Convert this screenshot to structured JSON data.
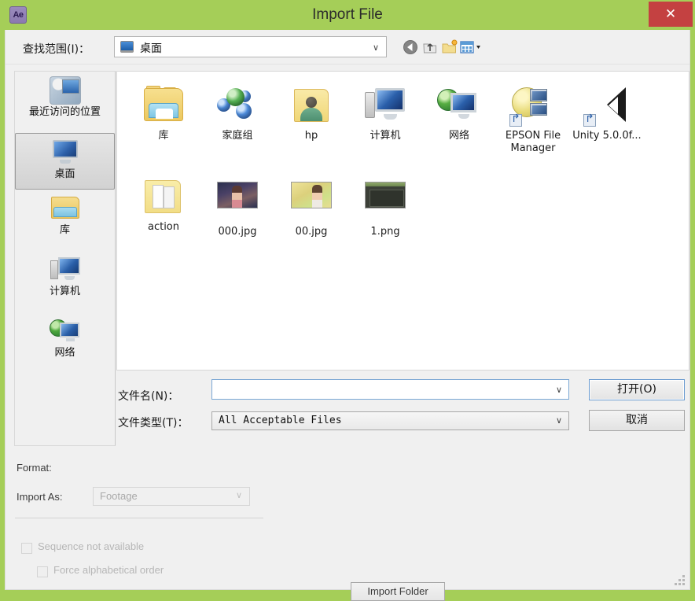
{
  "titlebar": {
    "app_icon": "after-effects-icon",
    "app_icon_text": "Ae",
    "title": "Import File",
    "close_label": "✕",
    "accent_color": "#a5ce58",
    "close_color": "#c44141"
  },
  "navbar": {
    "lookin_label": "查找范围(I)：",
    "lookin_value": "桌面",
    "dropdown_arrow": "∨",
    "toolbar_icons": [
      {
        "name": "back-icon",
        "glyph": "◀"
      },
      {
        "name": "up-folder-icon",
        "glyph": "▲"
      },
      {
        "name": "new-folder-icon",
        "glyph": "📁"
      },
      {
        "name": "views-icon",
        "glyph": "▦"
      }
    ]
  },
  "sidebar": {
    "items": [
      {
        "label": "最近访问的位置",
        "icon": "recent-places-icon",
        "selected": false
      },
      {
        "label": "桌面",
        "icon": "desktop-icon",
        "selected": true
      },
      {
        "label": "库",
        "icon": "libraries-icon",
        "selected": false
      },
      {
        "label": "计算机",
        "icon": "computer-icon",
        "selected": false
      },
      {
        "label": "网络",
        "icon": "network-icon",
        "selected": false
      }
    ]
  },
  "filelist": {
    "items": [
      {
        "label": "库",
        "icon": "libraries-folder-icon"
      },
      {
        "label": "家庭组",
        "icon": "homegroup-icon"
      },
      {
        "label": "hp",
        "icon": "user-folder-icon"
      },
      {
        "label": "计算机",
        "icon": "computer-icon"
      },
      {
        "label": "网络",
        "icon": "network-icon"
      },
      {
        "label": "EPSON File Manager",
        "icon": "epson-file-manager-icon"
      },
      {
        "label": "Unity 5.0.0f...",
        "icon": "unity-icon"
      },
      {
        "label": "action",
        "icon": "folder-icon"
      },
      {
        "label": "000.jpg",
        "icon": "image-thumbnail"
      },
      {
        "label": "00.jpg",
        "icon": "image-thumbnail"
      },
      {
        "label": "1.png",
        "icon": "image-thumbnail"
      }
    ]
  },
  "form": {
    "filename_label": "文件名(N)：",
    "filename_value": "",
    "filename_placeholder": "",
    "filetype_label": "文件类型(T)：",
    "filetype_value": "All Acceptable Files",
    "open_button": "打开(O)",
    "cancel_button": "取消",
    "dropdown_arrow": "∨"
  },
  "options": {
    "format_label": "Format:",
    "format_value": "",
    "import_as_label": "Import As:",
    "import_as_value": "Footage",
    "import_as_arrow": "∨",
    "sequence_label": "Sequence not available",
    "sequence_checked": false,
    "force_alpha_label": "Force alphabetical order",
    "force_alpha_checked": false,
    "import_folder_button": "Import Folder"
  }
}
